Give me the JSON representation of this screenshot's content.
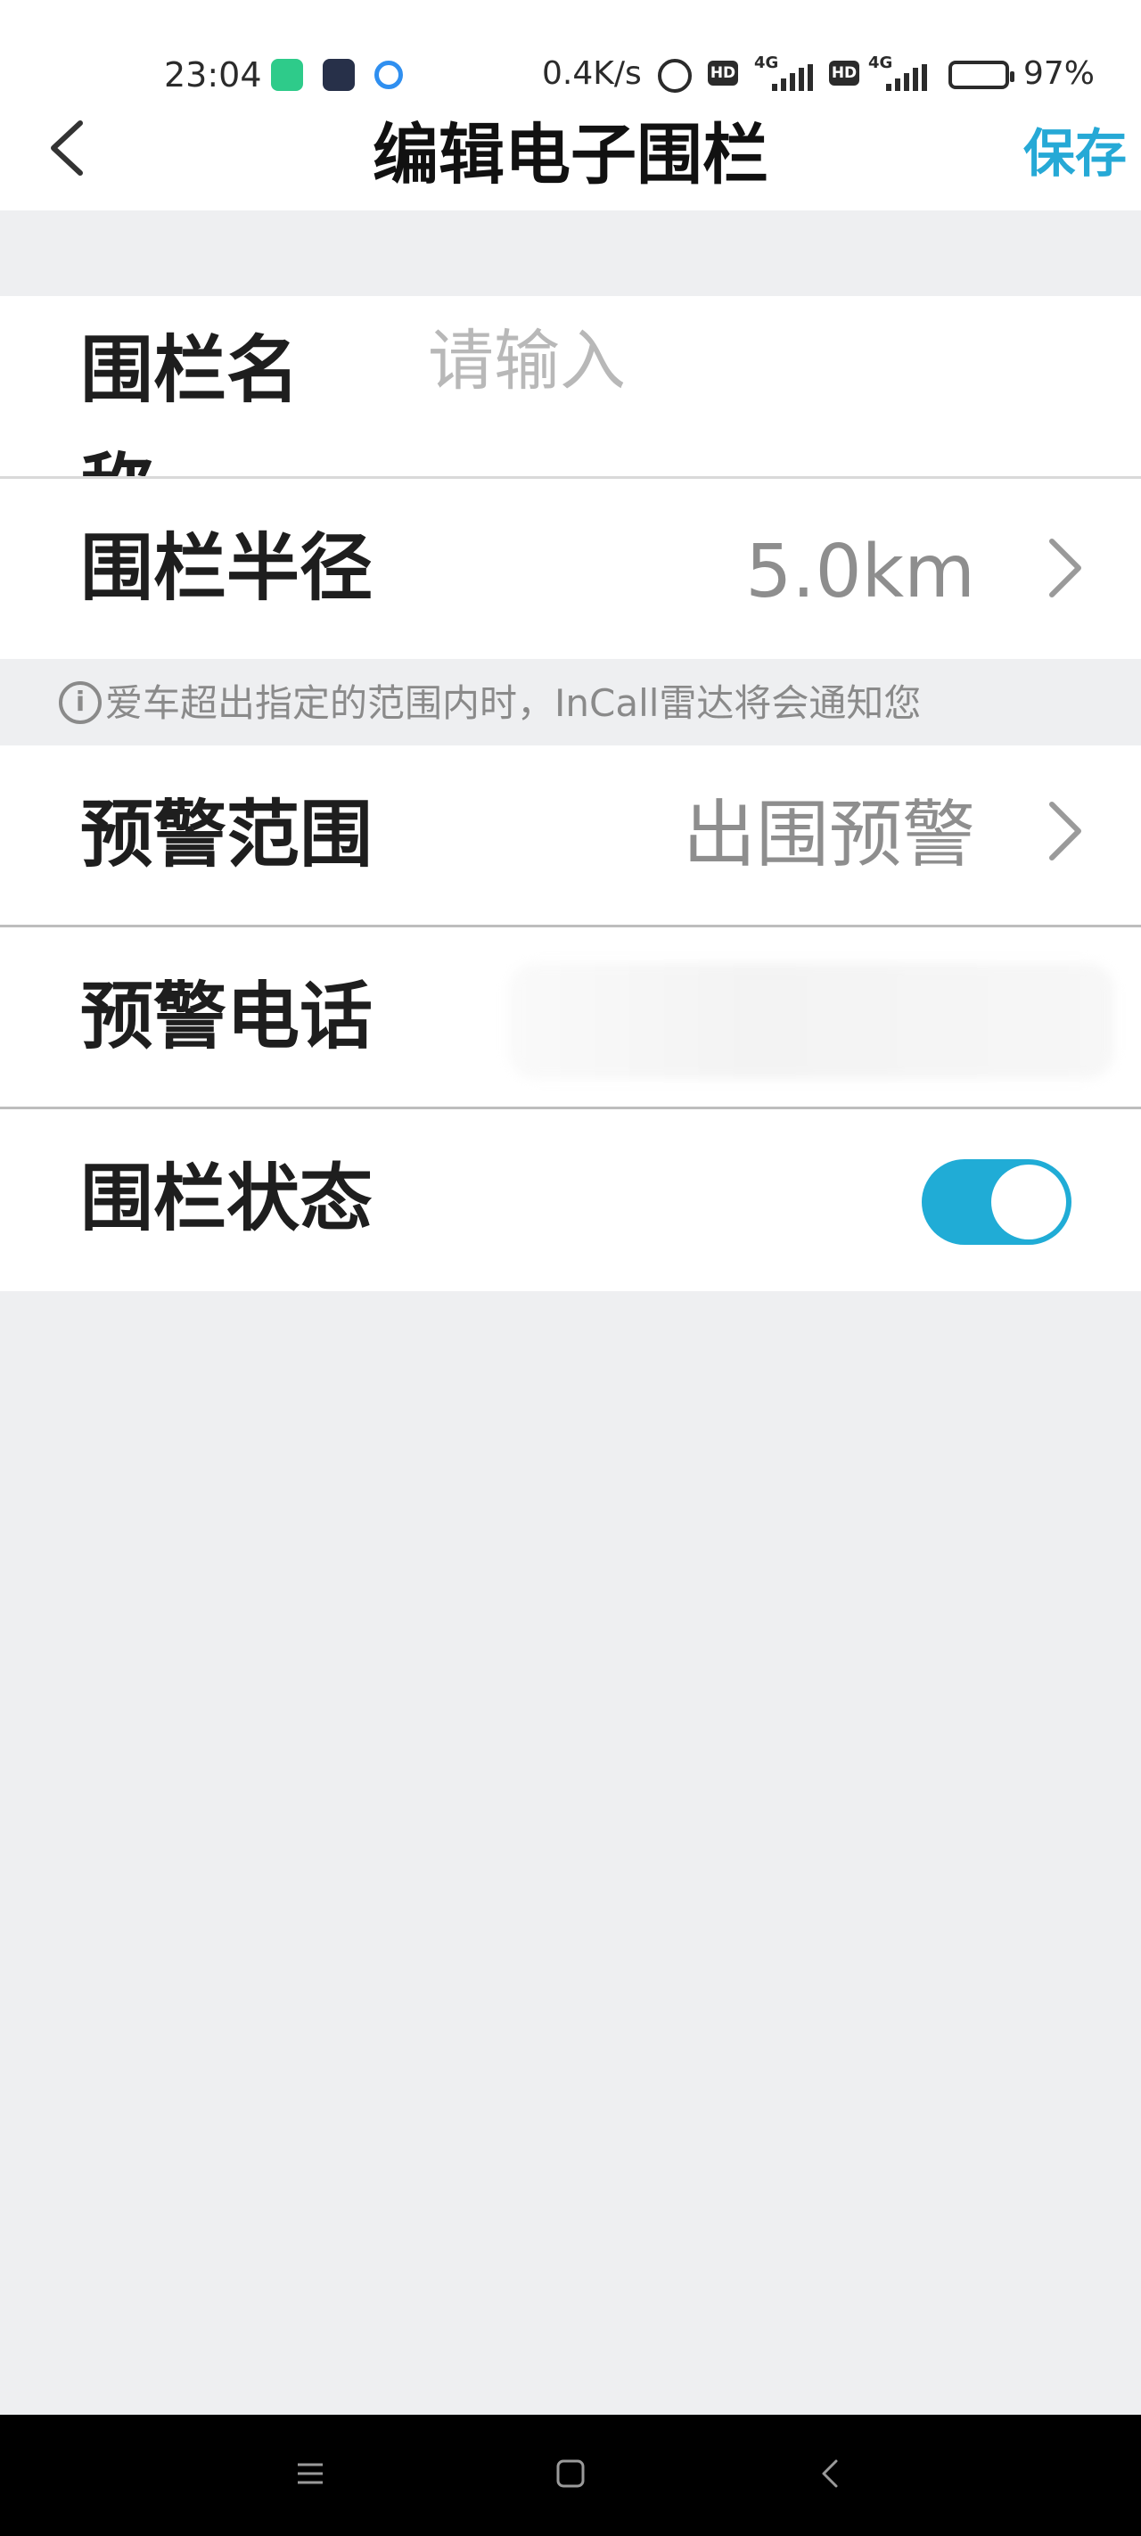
{
  "status_bar": {
    "time": "23:04",
    "network_speed": "0.4K/s",
    "network_type_1": "4G",
    "network_type_2": "4G",
    "hd_1": "HD",
    "hd_2": "HD",
    "battery_percent": "97%",
    "battery_level": 0.97,
    "icons": [
      "app-green-bolt-icon",
      "incall-app-icon",
      "blue-ring-app-icon",
      "alarm-icon",
      "signal-icon",
      "battery-icon"
    ]
  },
  "header": {
    "title": "编辑电子围栏",
    "save_label": "保存",
    "back_icon": "chevron-left-icon"
  },
  "form": {
    "name": {
      "label": "围栏名称",
      "placeholder": "请输入",
      "value": ""
    },
    "radius": {
      "label": "围栏半径",
      "value": "5.0km"
    },
    "hint": {
      "icon": "info-icon",
      "icon_glyph": "i",
      "text": "爱车超出指定的范围内时，InCall雷达将会通知您"
    },
    "alert_range": {
      "label": "预警范围",
      "value": "出围预警"
    },
    "alert_phone": {
      "label": "预警电话",
      "value_obscured": true
    },
    "fence_status": {
      "label": "围栏状态",
      "enabled": true
    }
  },
  "colors": {
    "accent": "#20acd6",
    "save_text": "#26a9d6",
    "background": "#eeeff1",
    "secondary_text": "#8e8e8e"
  },
  "system_nav": [
    "menu-icon",
    "home-icon",
    "back-icon"
  ]
}
